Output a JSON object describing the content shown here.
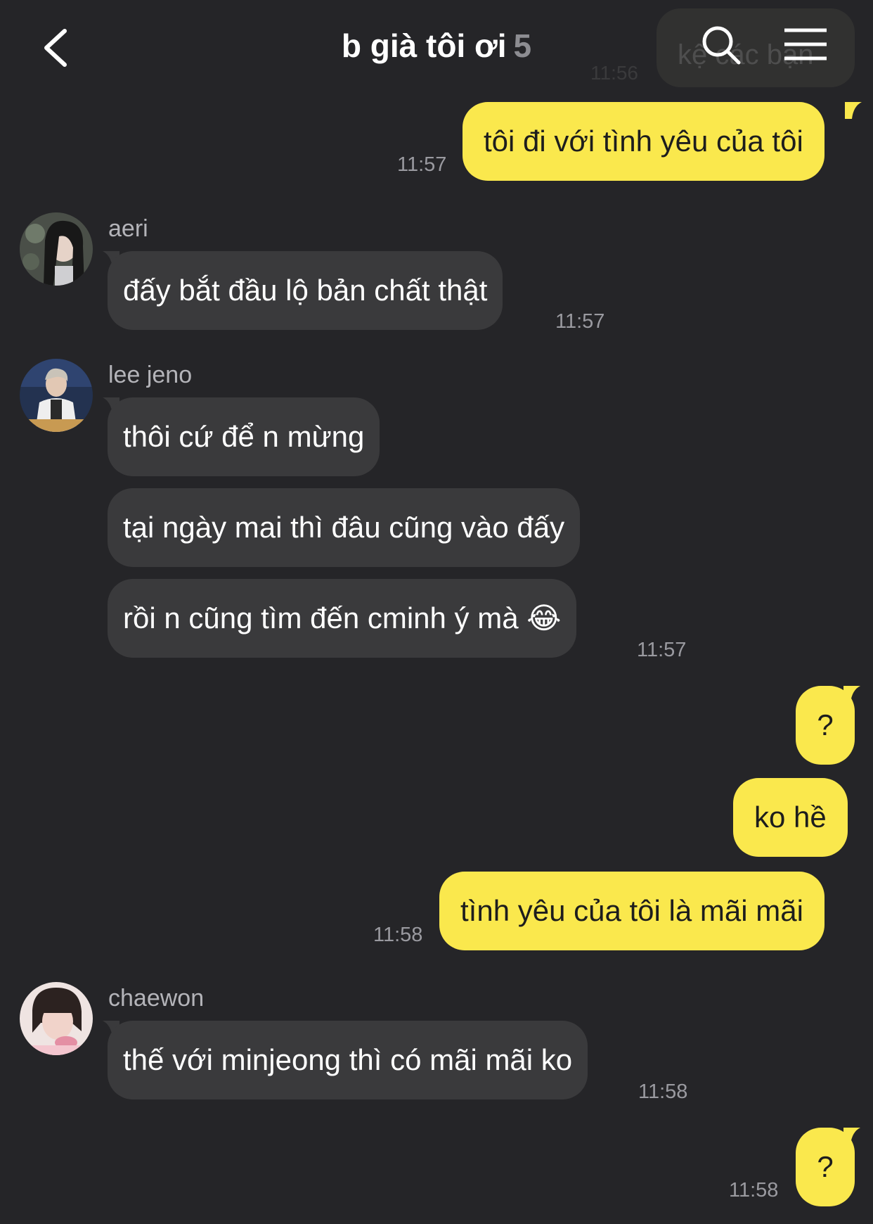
{
  "header": {
    "title": "b già tôi ơi",
    "member_count": "5",
    "ghost_preview": "kệ các bạn",
    "ghost_time": "11:56"
  },
  "messages": [
    {
      "from": "me",
      "text": "tôi đi với tình yêu của tôi",
      "time": "11:57"
    },
    {
      "from": "aeri",
      "sender": "aeri",
      "text": "đấy bắt đầu lộ bản chất thật",
      "time": "11:57"
    },
    {
      "from": "lee jeno",
      "sender": "lee jeno",
      "text": "thôi cứ để n mừng"
    },
    {
      "from": "lee jeno",
      "text": "tại ngày mai thì đâu cũng vào đấy"
    },
    {
      "from": "lee jeno",
      "text": "rồi n cũng tìm đến cminh ý mà 😂",
      "time": "11:57"
    },
    {
      "from": "me",
      "text": "?"
    },
    {
      "from": "me",
      "text": "ko hề"
    },
    {
      "from": "me",
      "text": "tình yêu của tôi là mãi mãi",
      "time": "11:58"
    },
    {
      "from": "chaewon",
      "sender": "chaewon",
      "text": "thế với minjeong thì có mãi mãi ko",
      "time": "11:58"
    },
    {
      "from": "me",
      "text": "?",
      "time": "11:58"
    }
  ],
  "colors": {
    "background": "#252528",
    "my_bubble": "#fae84d",
    "their_bubble": "#3a3a3c",
    "timestamp": "#9a9aa0"
  }
}
